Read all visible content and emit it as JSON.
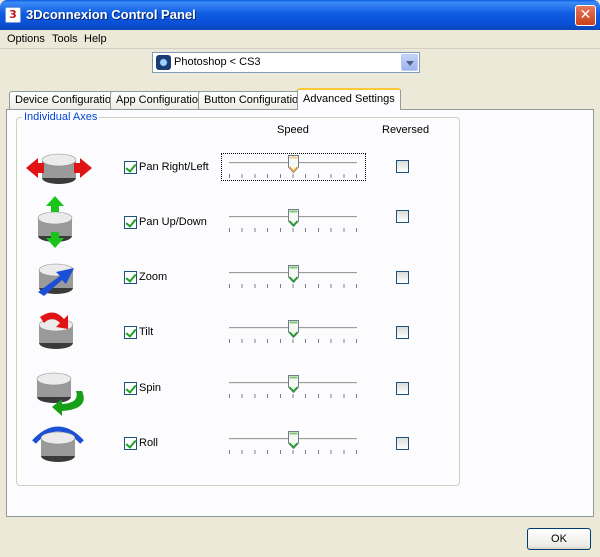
{
  "window": {
    "title": "3Dconnexion Control Panel",
    "close_glyph": "✕",
    "app_icon_glyph": "3"
  },
  "menu": [
    "Options",
    "Tools",
    "Help"
  ],
  "app_selector": {
    "value": "Photoshop < CS3"
  },
  "tabs": [
    {
      "label": "Device Configuration",
      "active": false
    },
    {
      "label": "App Configuration",
      "active": false
    },
    {
      "label": "Button Configuration",
      "active": false
    },
    {
      "label": "Advanced Settings",
      "active": true
    }
  ],
  "group": {
    "label": "Individual Axes"
  },
  "columns": {
    "speed": "Speed",
    "reversed": "Reversed"
  },
  "axes": [
    {
      "label": "Pan Right/Left",
      "enabled": true,
      "speed": 0.5,
      "reversed": false,
      "focused": true,
      "icon": "pan-right-left-icon"
    },
    {
      "label": "Pan Up/Down",
      "enabled": true,
      "speed": 0.5,
      "reversed": false,
      "focused": false,
      "icon": "pan-up-down-icon"
    },
    {
      "label": "Zoom",
      "enabled": true,
      "speed": 0.5,
      "reversed": false,
      "focused": false,
      "icon": "zoom-icon"
    },
    {
      "label": "Tilt",
      "enabled": true,
      "speed": 0.5,
      "reversed": false,
      "focused": false,
      "icon": "tilt-icon"
    },
    {
      "label": "Spin",
      "enabled": true,
      "speed": 0.5,
      "reversed": false,
      "focused": false,
      "icon": "spin-icon"
    },
    {
      "label": "Roll",
      "enabled": true,
      "speed": 0.5,
      "reversed": false,
      "focused": false,
      "icon": "roll-icon"
    }
  ],
  "ok_label": "OK",
  "colors": {
    "title_bar": "#0A5FE6",
    "group_label": "#0046D5",
    "check_mark": "#21A121",
    "thumb_focused": "#F3A33A",
    "thumb": "#21A121"
  }
}
